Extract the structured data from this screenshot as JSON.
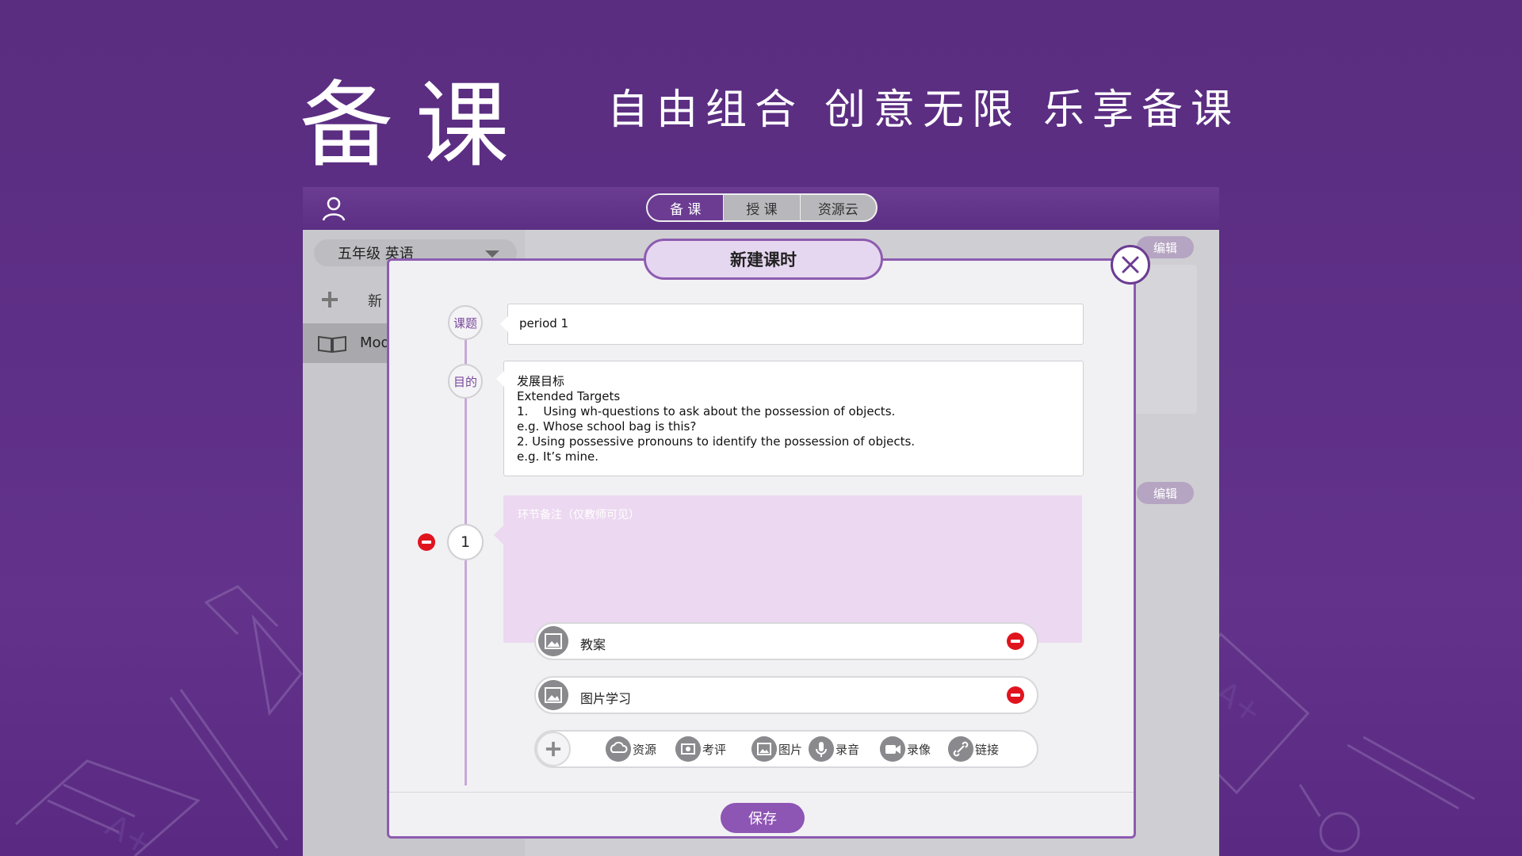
{
  "hero": {
    "title": "备课",
    "slogans": [
      "自由组合",
      "创意无限",
      "乐享备课"
    ]
  },
  "topbar": {
    "tabs": [
      {
        "label": "备 课",
        "active": true
      },
      {
        "label": "授 课",
        "active": false
      },
      {
        "label": "资源云",
        "active": false
      }
    ]
  },
  "sidebar": {
    "grade_select": "五年级  英语",
    "new_label": "新",
    "module_label": "Mod"
  },
  "right_panel": {
    "edit_label_1": "编辑",
    "edit_label_2": "编辑"
  },
  "dialog": {
    "title": "新建课时",
    "topic_label": "课题",
    "topic_value": "period 1",
    "purpose_label": "目的",
    "purpose_value": "发展目标\nExtended Targets\n1.    Using wh-questions to ask about the possession of objects.\ne.g. Whose school bag is this?\n2. Using possessive pronouns to identify the possession of objects.\ne.g. It’s mine.",
    "step_number": "1",
    "note_placeholder": "环节备注（仅教师可见）",
    "resources": [
      {
        "label": "教案",
        "icon": "image-icon"
      },
      {
        "label": "图片学习",
        "icon": "image-icon"
      }
    ],
    "tools": [
      {
        "label": "资源",
        "icon": "cloud-icon"
      },
      {
        "label": "考评",
        "icon": "assessment-icon"
      },
      {
        "label": "图片",
        "icon": "image-icon"
      },
      {
        "label": "录音",
        "icon": "microphone-icon"
      },
      {
        "label": "录像",
        "icon": "video-icon"
      },
      {
        "label": "链接",
        "icon": "link-icon"
      }
    ],
    "save_label": "保存"
  },
  "colors": {
    "brand_purple": "#6b3c92",
    "dialog_border": "#8d5cb0",
    "note_bg": "#ecd8f0",
    "remove_red": "#e0141e"
  }
}
